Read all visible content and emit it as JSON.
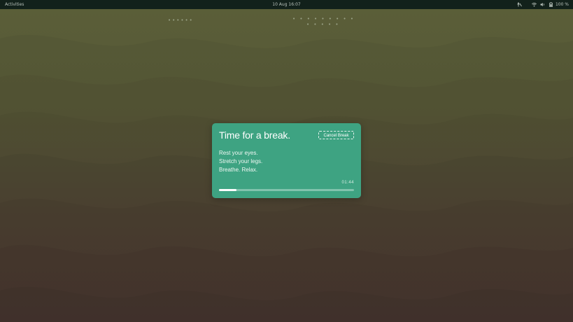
{
  "topbar": {
    "activities_label": "Activities",
    "clock": "10 Aug  16:07",
    "battery_label": "100 %",
    "icons": [
      "accessibility-icon",
      "wifi-icon",
      "volume-icon",
      "battery-icon"
    ]
  },
  "dialog": {
    "title": "Time for a break.",
    "cancel_label": "Cancel Break",
    "messages": [
      "Rest your eyes.",
      "Stretch your legs.",
      "Breathe. Relax."
    ],
    "timer": "01:44",
    "progress": 0.13
  },
  "colors": {
    "dialog_bg": "#3ea382",
    "topbar_bg": "#12211b",
    "background_top": "#5a5e38",
    "background_bottom": "#56423a"
  }
}
